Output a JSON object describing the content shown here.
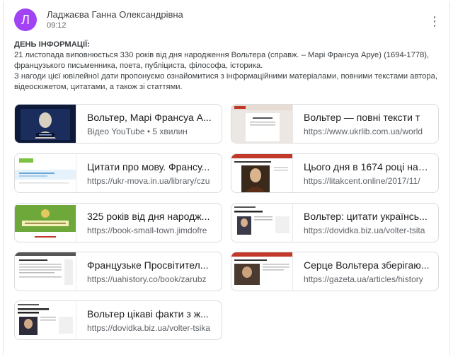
{
  "header": {
    "avatar_letter": "Л",
    "avatar_color": "#a142f4",
    "author": "Ладжаєва Ганна Олександрівна",
    "time": "09:12"
  },
  "post": {
    "title": "ДЕНЬ ІНФОРМАЦІЇ:",
    "line1": "21 листопада виповнюється 330 років від дня народження Вольтера (справж. – Марі Франсуа Аруе) (1694-1778),",
    "line2": "французького письменника, поета, публіциста, філософа, історика.",
    "line3": "З нагоди цієї ювілейної дати пропонуємо ознайомитися з інформаційними матеріалами, повними текстами автора,",
    "line4": "відеосюжетом, цитатами, а також зі статтями."
  },
  "attachments": [
    {
      "title": "Вольтер, Марі Франсуа А...",
      "subtitle": "Відео YouTube • 5 хвилин",
      "thumb": "youtube-video-thumbnail"
    },
    {
      "title": "Вольтер — повні тексти т",
      "subtitle": "https://www.ukrlib.com.ua/world",
      "thumb": "webpage-thumbnail"
    },
    {
      "title": "Цитати про мову. Франсу...",
      "subtitle": "https://ukr-mova.in.ua/library/czu",
      "thumb": "webpage-thumbnail"
    },
    {
      "title": "Цього дня в 1674 році нар...",
      "subtitle": "https://litakcent.online/2017/11/",
      "thumb": "portrait-thumbnail"
    },
    {
      "title": "325 років від дня народж...",
      "subtitle": "https://book-small-town.jimdofre",
      "thumb": "banner-thumbnail"
    },
    {
      "title": "Вольтер: цитати українсь...",
      "subtitle": "https://dovidka.biz.ua/volter-tsita",
      "thumb": "article-thumbnail"
    },
    {
      "title": "Французьке Просвітител...",
      "subtitle": "https://uahistory.co/book/zarubz",
      "thumb": "document-thumbnail"
    },
    {
      "title": "Серце Вольтера зберігаю...",
      "subtitle": "https://gazeta.ua/articles/history",
      "thumb": "news-thumbnail"
    },
    {
      "title": "Вольтер цікаві факти з ж...",
      "subtitle": "https://dovidka.biz.ua/volter-tsika",
      "thumb": "article-thumbnail"
    }
  ]
}
